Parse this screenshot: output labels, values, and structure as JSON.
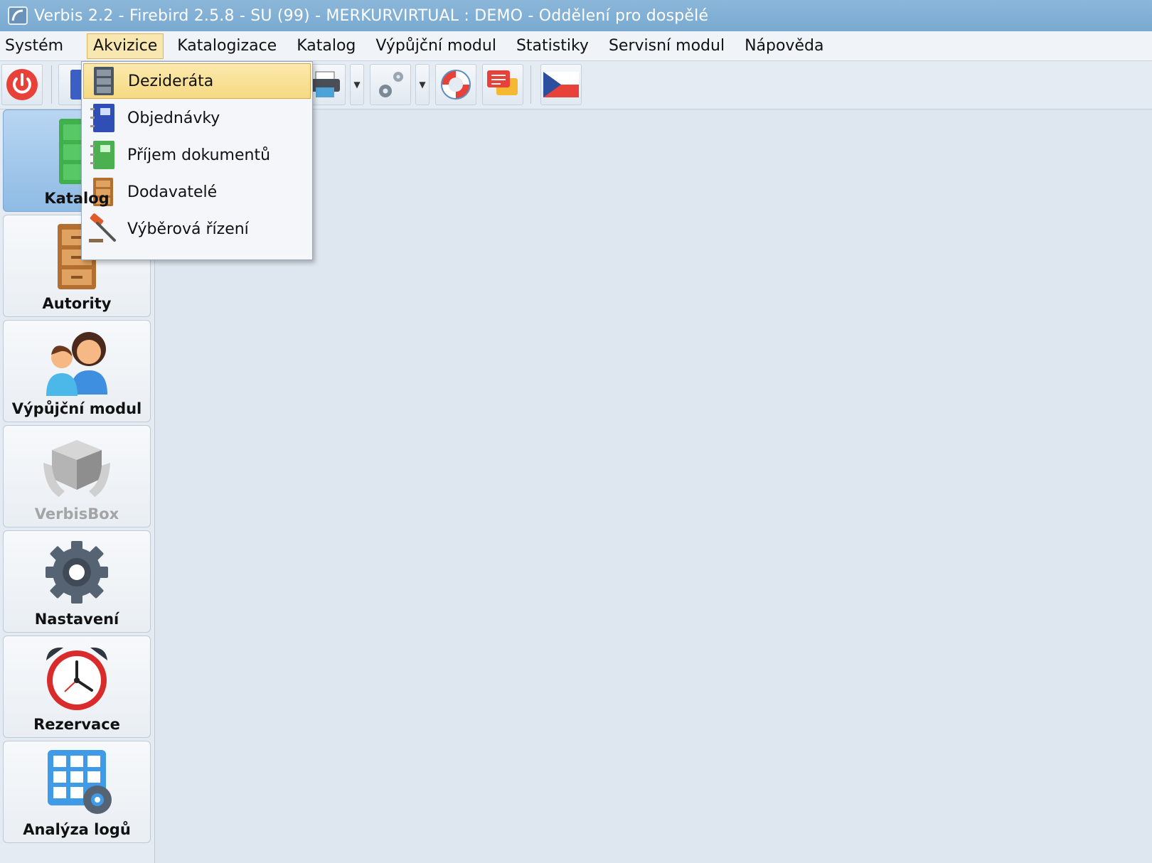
{
  "window": {
    "title": "Verbis 2.2 - Firebird 2.5.8 - SU (99) - MERKURVIRTUAL : DEMO - Oddělení pro dospělé"
  },
  "menubar": {
    "items": [
      {
        "label": "Systém"
      },
      {
        "label": "Akvizice",
        "active": true
      },
      {
        "label": "Katalogizace"
      },
      {
        "label": "Katalog"
      },
      {
        "label": "Výpůjční modul"
      },
      {
        "label": "Statistiky"
      },
      {
        "label": "Servisní modul"
      },
      {
        "label": "Nápověda"
      }
    ]
  },
  "dropdown": {
    "items": [
      {
        "label": "Dezideráta",
        "icon": "cabinet-gray-icon",
        "highlighted": true
      },
      {
        "label": "Objednávky",
        "icon": "notebook-blue-icon"
      },
      {
        "label": "Příjem dokumentů",
        "icon": "notebook-green-icon"
      },
      {
        "label": "Dodavatelé",
        "icon": "cabinet-brown-icon"
      },
      {
        "label": "Výběrová řízení",
        "icon": "gavel-icon"
      }
    ]
  },
  "toolbar": {
    "icons": [
      "power-icon",
      "catalog-icon",
      "printer-icon",
      "gears-icon",
      "lifebuoy-icon",
      "chat-icon",
      "czech-flag-icon"
    ]
  },
  "sidebar": {
    "items": [
      {
        "label": "Katalog",
        "icon": "cabinet-green-icon",
        "selected": true
      },
      {
        "label": "Autority",
        "icon": "cabinet-brown-icon"
      },
      {
        "label": "Výpůjční modul",
        "icon": "people-icon"
      },
      {
        "label": "VerbisBox",
        "icon": "box-hands-icon",
        "disabled": true
      },
      {
        "label": "Nastavení",
        "icon": "gear-icon"
      },
      {
        "label": "Rezervace",
        "icon": "alarm-clock-icon"
      },
      {
        "label": "Analýza logů",
        "icon": "grid-gear-icon"
      }
    ]
  },
  "colors": {
    "titlebar": "#7aaad2",
    "menu_active": "#f9e7b1",
    "highlight": "#f6d982",
    "selected_sidebar": "#8fbbe4"
  }
}
